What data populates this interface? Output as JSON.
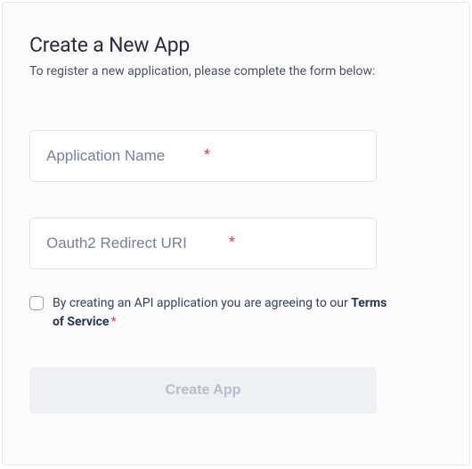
{
  "header": {
    "title": "Create a New App",
    "subtitle": "To register a new application, please complete the form below:"
  },
  "form": {
    "app_name": {
      "placeholder": "Application Name",
      "value": "",
      "required_marker": "*"
    },
    "redirect_uri": {
      "placeholder": "Oauth2 Redirect URI",
      "value": "",
      "required_marker": "*"
    },
    "consent": {
      "prefix": "By creating an API application you are agreeing to our ",
      "tos_label": "Terms of Service",
      "required_marker": "*",
      "checked": false
    },
    "submit_label": "Create App"
  },
  "colors": {
    "card_bg": "#fcfcfd",
    "border": "#e8e9ec",
    "title": "#2a2f3c",
    "subtitle": "#4a5160",
    "placeholder": "#778099",
    "required": "#df3b63",
    "button_bg_disabled": "#eef0f3",
    "button_text_disabled": "#b7becb"
  }
}
